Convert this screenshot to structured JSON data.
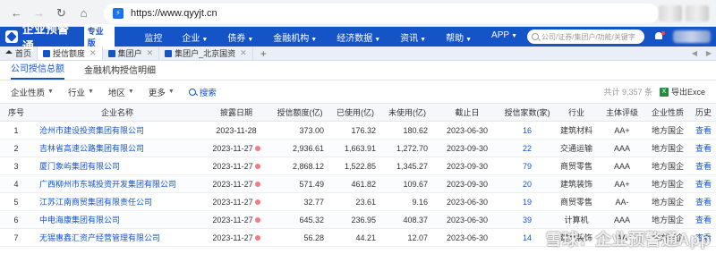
{
  "browser": {
    "url": "https://www.qyyjt.cn",
    "back_icon": "arrow-left-icon",
    "forward_icon": "arrow-right-icon",
    "reload_icon": "reload-icon",
    "home_icon": "home-icon"
  },
  "header": {
    "logo_text": "企业预警通",
    "pro_badge": "专业版",
    "nav": [
      {
        "label": "监控",
        "caret": false
      },
      {
        "label": "企业",
        "caret": true
      },
      {
        "label": "债券",
        "caret": true
      },
      {
        "label": "金融机构",
        "caret": true
      },
      {
        "label": "经济数据",
        "caret": true
      },
      {
        "label": "资讯",
        "caret": true
      },
      {
        "label": "帮助",
        "caret": true
      },
      {
        "label": "APP",
        "caret": true
      }
    ],
    "search_placeholder": "公司/证券/集团户/功能/关键字",
    "brand_color": "#1554c7"
  },
  "tabs": [
    {
      "label": "首页",
      "active": false,
      "closable": false
    },
    {
      "label": "授信额度",
      "active": true,
      "closable": true
    },
    {
      "label": "集团户",
      "active": false,
      "closable": true
    },
    {
      "label": "集团户_北京国资",
      "active": false,
      "closable": true
    }
  ],
  "sub_tabs": [
    {
      "label": "公司授信总额",
      "active": true
    },
    {
      "label": "金融机构授信明细",
      "active": false
    }
  ],
  "filters": {
    "items": [
      "企业性质",
      "行业",
      "地区",
      "更多"
    ],
    "search_label": "搜索",
    "total_text": "共计 9,357 条",
    "export_label": "导出Exce"
  },
  "table": {
    "headers": [
      "序号",
      "企业名称",
      "披露日期",
      "授信额度(亿)",
      "已使用(亿)",
      "未使用(亿)",
      "截止日",
      "授信家数(家)",
      "行业",
      "主体评级",
      "企业性质",
      "历史"
    ],
    "rows": [
      {
        "no": "1",
        "name": "沧州市建设投资集团有限公司",
        "date": "2023-11-28",
        "marked": false,
        "credit": "373.00",
        "used": "176.32",
        "unused": "180.62",
        "cutoff": "2023-06-30",
        "banks": "16",
        "industry": "建筑材料",
        "rating": "AA+",
        "nature": "地方国企",
        "history": "查看"
      },
      {
        "no": "2",
        "name": "吉林省高速公路集团有限公司",
        "date": "2023-11-27",
        "marked": true,
        "credit": "2,936.61",
        "used": "1,663.91",
        "unused": "1,272.70",
        "cutoff": "2023-09-30",
        "banks": "22",
        "industry": "交通运输",
        "rating": "AAA",
        "nature": "地方国企",
        "history": "查看"
      },
      {
        "no": "3",
        "name": "厦门象屿集团有限公司",
        "date": "2023-11-27",
        "marked": true,
        "credit": "2,868.12",
        "used": "1,522.85",
        "unused": "1,345.27",
        "cutoff": "2023-09-30",
        "banks": "79",
        "industry": "商贸零售",
        "rating": "AAA",
        "nature": "地方国企",
        "history": "查看"
      },
      {
        "no": "4",
        "name": "广西柳州市东城投资开发集团有限公司",
        "date": "2023-11-27",
        "marked": true,
        "credit": "571.49",
        "used": "461.82",
        "unused": "109.67",
        "cutoff": "2023-09-30",
        "banks": "20",
        "industry": "建筑装饰",
        "rating": "AA+",
        "nature": "地方国企",
        "history": "查看"
      },
      {
        "no": "5",
        "name": "江苏江南商贸集团有限责任公司",
        "date": "2023-11-27",
        "marked": true,
        "credit": "32.77",
        "used": "23.61",
        "unused": "9.16",
        "cutoff": "2023-06-30",
        "banks": "19",
        "industry": "商贸零售",
        "rating": "AA-",
        "nature": "地方国企",
        "history": "查看"
      },
      {
        "no": "6",
        "name": "中电海康集团有限公司",
        "date": "2023-11-27",
        "marked": true,
        "credit": "645.32",
        "used": "236.95",
        "unused": "408.37",
        "cutoff": "2023-06-30",
        "banks": "39",
        "industry": "计算机",
        "rating": "AAA",
        "nature": "地方国企",
        "history": "查看"
      },
      {
        "no": "7",
        "name": "无锡惠鑫汇资产经营管理有限公司",
        "date": "2023-11-27",
        "marked": true,
        "credit": "56.28",
        "used": "44.21",
        "unused": "12.07",
        "cutoff": "2023-06-30",
        "banks": "14",
        "industry": "建筑装饰",
        "rating": "AA",
        "nature": "地方国企",
        "history": "查看"
      }
    ]
  },
  "watermark": "雪球：企业预警通App"
}
